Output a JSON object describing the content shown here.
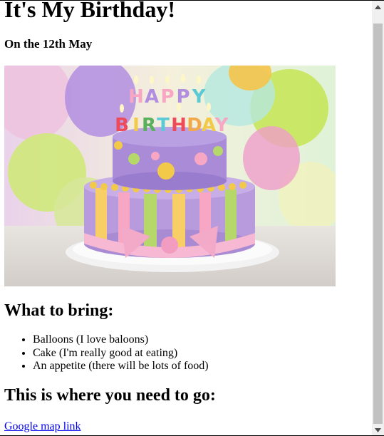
{
  "page": {
    "title": "It's My Birthday!",
    "date": "On the 12th May",
    "bring_heading": "What to bring:",
    "bring_items": [
      "Balloons (I love baloons)",
      "Cake (I'm really good at eating)",
      "An appetite (there will be lots of food)"
    ],
    "location_heading": "This is where you need to go:",
    "map_link": "Google map link"
  },
  "image": {
    "cake_letters": "HAPPY BIRTHDAY",
    "icon": "birthday-cake-photo"
  },
  "scrollbar": {
    "up_icon": "scroll-up-arrow-icon",
    "down_icon": "scroll-down-arrow-icon"
  }
}
